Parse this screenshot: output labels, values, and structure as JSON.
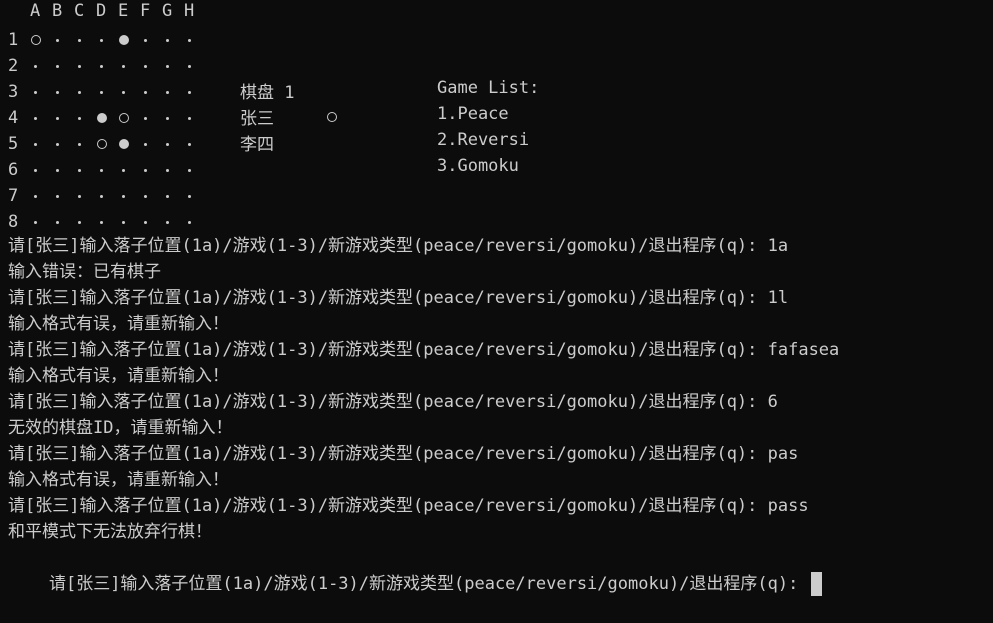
{
  "board": {
    "columns": [
      "A",
      "B",
      "C",
      "D",
      "E",
      "F",
      "G",
      "H"
    ],
    "rows": [
      "1",
      "2",
      "3",
      "4",
      "5",
      "6",
      "7",
      "8"
    ],
    "cells": [
      [
        "white",
        "empty",
        "empty",
        "empty",
        "black",
        "empty",
        "empty",
        "empty"
      ],
      [
        "empty",
        "empty",
        "empty",
        "empty",
        "empty",
        "empty",
        "empty",
        "empty"
      ],
      [
        "empty",
        "empty",
        "empty",
        "empty",
        "empty",
        "empty",
        "empty",
        "empty"
      ],
      [
        "empty",
        "empty",
        "empty",
        "black",
        "white",
        "empty",
        "empty",
        "empty"
      ],
      [
        "empty",
        "empty",
        "empty",
        "white",
        "black",
        "empty",
        "empty",
        "empty"
      ],
      [
        "empty",
        "empty",
        "empty",
        "empty",
        "empty",
        "empty",
        "empty",
        "empty"
      ],
      [
        "empty",
        "empty",
        "empty",
        "empty",
        "empty",
        "empty",
        "empty",
        "empty"
      ],
      [
        "empty",
        "empty",
        "empty",
        "empty",
        "empty",
        "empty",
        "empty",
        "empty"
      ]
    ]
  },
  "info": {
    "board_title": "棋盘 1",
    "player1": "张三",
    "player2": "李四",
    "game_list_title": "Game List:",
    "games": [
      "1.Peace",
      "2.Reversi",
      "3.Gomoku"
    ]
  },
  "log": [
    "请[张三]输入落子位置(1a)/游戏(1-3)/新游戏类型(peace/reversi/gomoku)/退出程序(q): 1a",
    "输入错误：已有棋子",
    "请[张三]输入落子位置(1a)/游戏(1-3)/新游戏类型(peace/reversi/gomoku)/退出程序(q): 1l",
    "输入格式有误，请重新输入！",
    "请[张三]输入落子位置(1a)/游戏(1-3)/新游戏类型(peace/reversi/gomoku)/退出程序(q): fafasea",
    "输入格式有误，请重新输入！",
    "请[张三]输入落子位置(1a)/游戏(1-3)/新游戏类型(peace/reversi/gomoku)/退出程序(q): 6",
    "无效的棋盘ID，请重新输入！",
    "请[张三]输入落子位置(1a)/游戏(1-3)/新游戏类型(peace/reversi/gomoku)/退出程序(q): pas",
    "输入格式有误，请重新输入！",
    "请[张三]输入落子位置(1a)/游戏(1-3)/新游戏类型(peace/reversi/gomoku)/退出程序(q): pass",
    "和平模式下无法放弃行棋！"
  ],
  "prompt": "请[张三]输入落子位置(1a)/游戏(1-3)/新游戏类型(peace/reversi/gomoku)/退出程序(q): ",
  "colors": {
    "background": "#0c0c0c",
    "text": "#cccccc"
  }
}
